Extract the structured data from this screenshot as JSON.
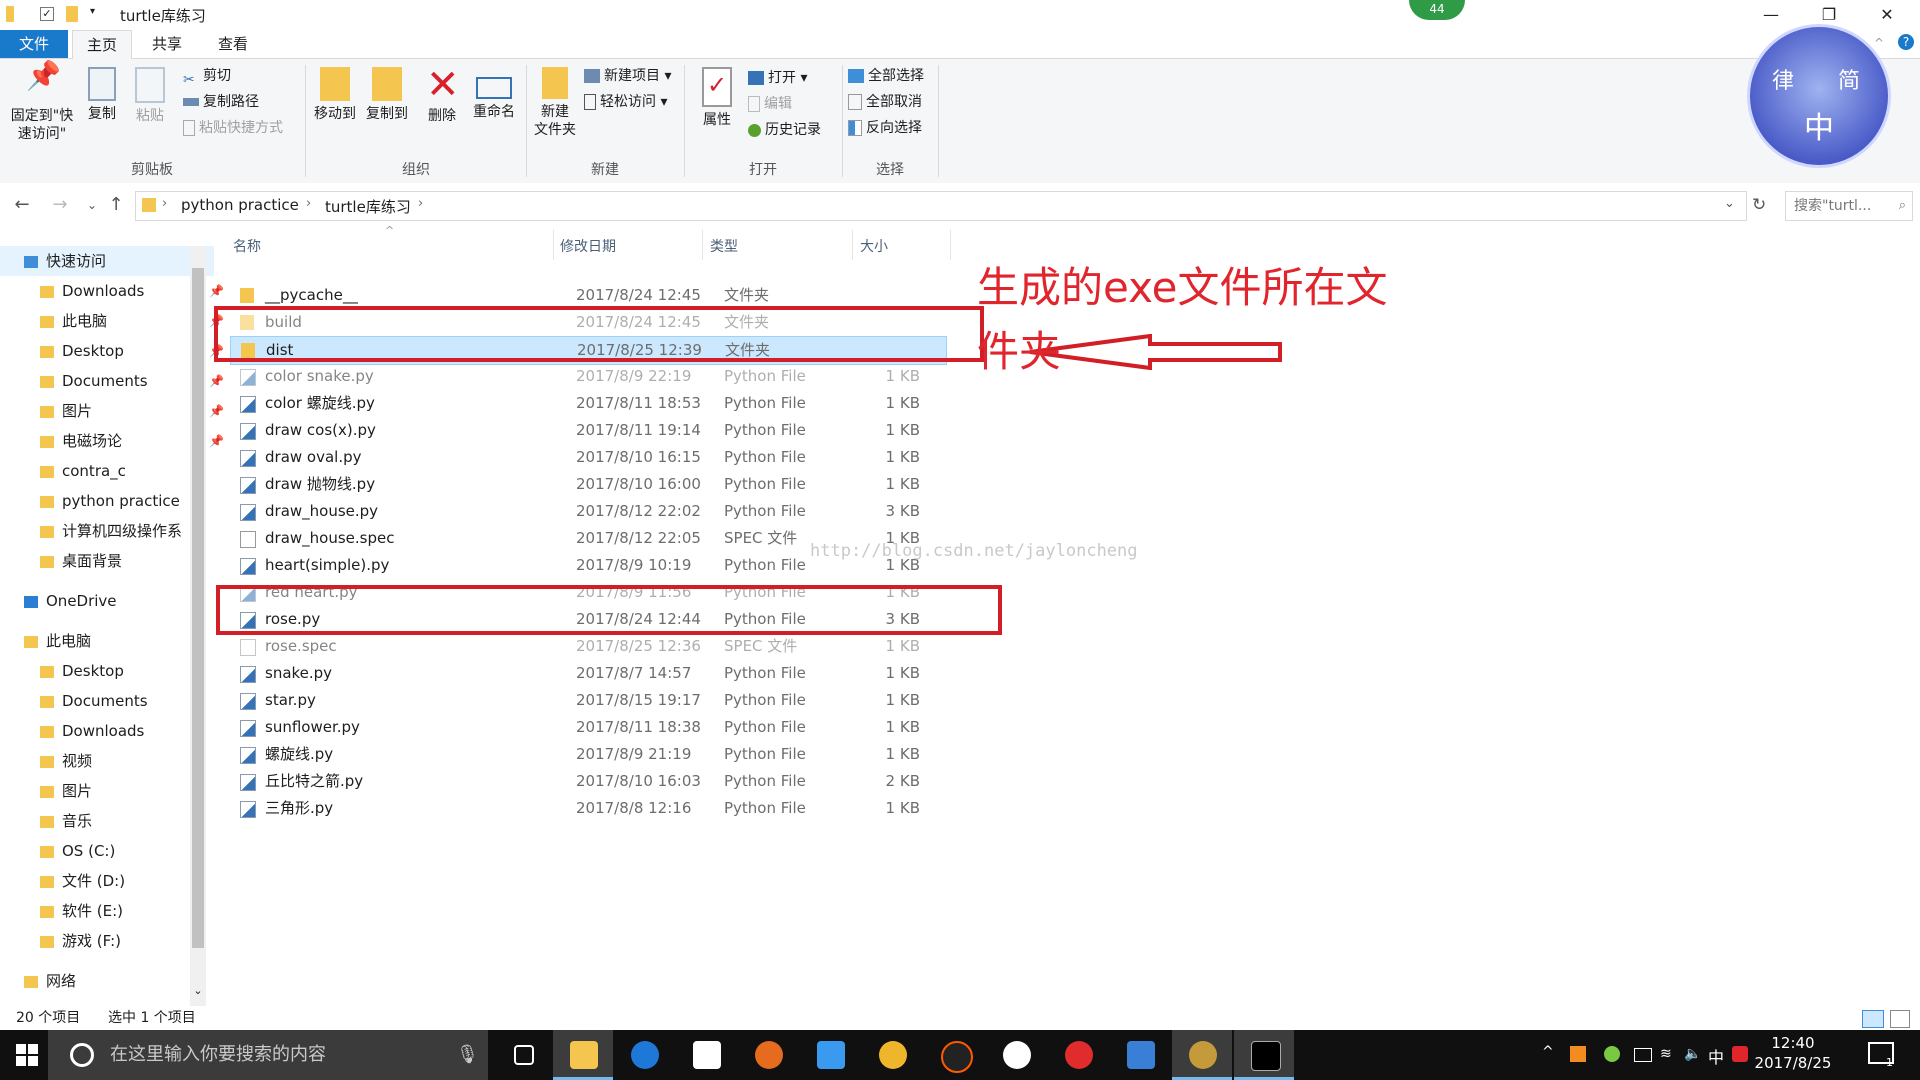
{
  "window": {
    "title": "turtle库练习",
    "controls": [
      "—",
      "❐",
      "✕"
    ]
  },
  "tabs": [
    "文件",
    "主页",
    "共享",
    "查看"
  ],
  "ribbon": {
    "clipboard": {
      "pin": "固定到\"快速访问\"",
      "copy": "复制",
      "paste": "粘贴",
      "cut": "剪切",
      "copy_path": "复制路径",
      "paste_shortcut": "粘贴快捷方式",
      "group": "剪贴板"
    },
    "organize": {
      "move_to": "移动到",
      "copy_to": "复制到",
      "delete": "删除",
      "rename": "重命名",
      "group": "组织"
    },
    "new": {
      "new_folder": "新建\n文件夹",
      "new_item": "新建项目",
      "easy_access": "轻松访问",
      "group": "新建"
    },
    "open": {
      "properties": "属性",
      "open": "打开",
      "edit": "编辑",
      "history": "历史记录",
      "group": "打开"
    },
    "select": {
      "select_all": "全部选择",
      "select_none": "全部取消",
      "invert": "反向选择",
      "group": "选择"
    }
  },
  "address": {
    "crumbs": [
      "python practice",
      "turtle库练习"
    ],
    "search_placeholder": "搜索\"turtl...",
    "sort_arrow": "^"
  },
  "sidebar": {
    "items": [
      {
        "label": "快速访问",
        "pinned": false
      },
      {
        "label": "Downloads",
        "pinned": true
      },
      {
        "label": "此电脑",
        "pinned": true
      },
      {
        "label": "Desktop",
        "pinned": true
      },
      {
        "label": "Documents",
        "pinned": true
      },
      {
        "label": "图片",
        "pinned": true
      },
      {
        "label": "电磁场论",
        "pinned": true
      },
      {
        "label": "contra_c",
        "pinned": false
      },
      {
        "label": "python practice",
        "pinned": false
      },
      {
        "label": "计算机四级操作系",
        "pinned": false
      },
      {
        "label": "桌面背景",
        "pinned": false
      },
      {
        "label": "OneDrive",
        "pinned": false
      },
      {
        "label": "此电脑",
        "pinned": false
      },
      {
        "label": "Desktop",
        "pinned": false
      },
      {
        "label": "Documents",
        "pinned": false
      },
      {
        "label": "Downloads",
        "pinned": false
      },
      {
        "label": "视频",
        "pinned": false
      },
      {
        "label": "图片",
        "pinned": false
      },
      {
        "label": "音乐",
        "pinned": false
      },
      {
        "label": "OS (C:)",
        "pinned": false
      },
      {
        "label": "文件 (D:)",
        "pinned": false
      },
      {
        "label": "软件 (E:)",
        "pinned": false
      },
      {
        "label": "游戏 (F:)",
        "pinned": false
      },
      {
        "label": "网络",
        "pinned": false
      }
    ]
  },
  "columns": [
    "名称",
    "修改日期",
    "类型",
    "大小"
  ],
  "files": [
    {
      "name": "__pycache__",
      "date": "2017/8/24 12:45",
      "type": "文件夹",
      "size": "",
      "kind": "folder"
    },
    {
      "name": "build",
      "date": "2017/8/24 12:45",
      "type": "文件夹",
      "size": "",
      "kind": "folder"
    },
    {
      "name": "dist",
      "date": "2017/8/25 12:39",
      "type": "文件夹",
      "size": "",
      "kind": "folder"
    },
    {
      "name": "color snake.py",
      "date": "2017/8/9 22:19",
      "type": "Python File",
      "size": "1 KB",
      "kind": "py"
    },
    {
      "name": "color 螺旋线.py",
      "date": "2017/8/11 18:53",
      "type": "Python File",
      "size": "1 KB",
      "kind": "py"
    },
    {
      "name": "draw cos(x).py",
      "date": "2017/8/11 19:14",
      "type": "Python File",
      "size": "1 KB",
      "kind": "py"
    },
    {
      "name": "draw oval.py",
      "date": "2017/8/10 16:15",
      "type": "Python File",
      "size": "1 KB",
      "kind": "py"
    },
    {
      "name": "draw 抛物线.py",
      "date": "2017/8/10 16:00",
      "type": "Python File",
      "size": "1 KB",
      "kind": "py"
    },
    {
      "name": "draw_house.py",
      "date": "2017/8/12 22:02",
      "type": "Python File",
      "size": "3 KB",
      "kind": "py"
    },
    {
      "name": "draw_house.spec",
      "date": "2017/8/12 22:05",
      "type": "SPEC 文件",
      "size": "1 KB",
      "kind": "doc"
    },
    {
      "name": "heart(simple).py",
      "date": "2017/8/9 10:19",
      "type": "Python File",
      "size": "1 KB",
      "kind": "py"
    },
    {
      "name": "red heart.py",
      "date": "2017/8/9 11:56",
      "type": "Python File",
      "size": "1 KB",
      "kind": "py"
    },
    {
      "name": "rose.py",
      "date": "2017/8/24 12:44",
      "type": "Python File",
      "size": "3 KB",
      "kind": "py"
    },
    {
      "name": "rose.spec",
      "date": "2017/8/25 12:36",
      "type": "SPEC 文件",
      "size": "1 KB",
      "kind": "doc"
    },
    {
      "name": "snake.py",
      "date": "2017/8/7 14:57",
      "type": "Python File",
      "size": "1 KB",
      "kind": "py"
    },
    {
      "name": "star.py",
      "date": "2017/8/15 19:17",
      "type": "Python File",
      "size": "1 KB",
      "kind": "py"
    },
    {
      "name": "sunflower.py",
      "date": "2017/8/11 18:38",
      "type": "Python File",
      "size": "1 KB",
      "kind": "py"
    },
    {
      "name": "螺旋线.py",
      "date": "2017/8/9 21:19",
      "type": "Python File",
      "size": "1 KB",
      "kind": "py"
    },
    {
      "name": "丘比特之箭.py",
      "date": "2017/8/10 16:03",
      "type": "Python File",
      "size": "2 KB",
      "kind": "py"
    },
    {
      "name": "三角形.py",
      "date": "2017/8/8 12:16",
      "type": "Python File",
      "size": "1 KB",
      "kind": "py"
    }
  ],
  "annotation": {
    "text": "生成的exe文件所在文件夹",
    "color": "#e0252d"
  },
  "watermark": "http://blog.csdn.net/jayloncheng",
  "status": {
    "count": "20 个项目",
    "selected": "选中 1 个项目"
  },
  "taskbar": {
    "search_placeholder": "在这里输入你要搜索的内容",
    "time": "12:40",
    "date": "2017/8/25",
    "ime": "中",
    "notification_count": "1"
  },
  "overlay": {
    "badge": "44",
    "avatar_chars": [
      "律",
      "简",
      "中"
    ]
  },
  "colors": {
    "accent": "#1979ca",
    "selection": "#cce8ff",
    "folder": "#f4c64f"
  }
}
